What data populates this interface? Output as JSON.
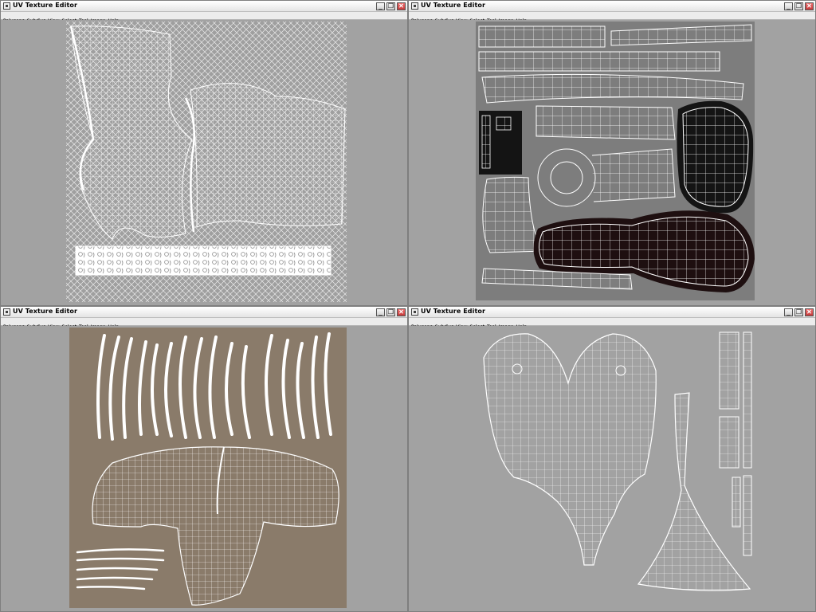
{
  "windows": [
    {
      "title": "UV Texture Editor"
    },
    {
      "title": "UV Texture Editor"
    },
    {
      "title": "UV Texture Editor"
    },
    {
      "title": "UV Texture Editor"
    }
  ],
  "menu": [
    "Polygons",
    "Subdivs",
    "View",
    "Select",
    "Tool",
    "Image",
    "Help"
  ],
  "window_buttons": {
    "minimize": "_",
    "restore": "❐",
    "close": "✕"
  },
  "colors": {
    "canvas_gray": "#a2a2a2",
    "uv_wire": "#ffffff",
    "texture_gray": "#7d7d7d",
    "texture_dark": "#141414",
    "texture_dark_red": "#1e0f10",
    "texture_tan": "#8a7b6a"
  }
}
